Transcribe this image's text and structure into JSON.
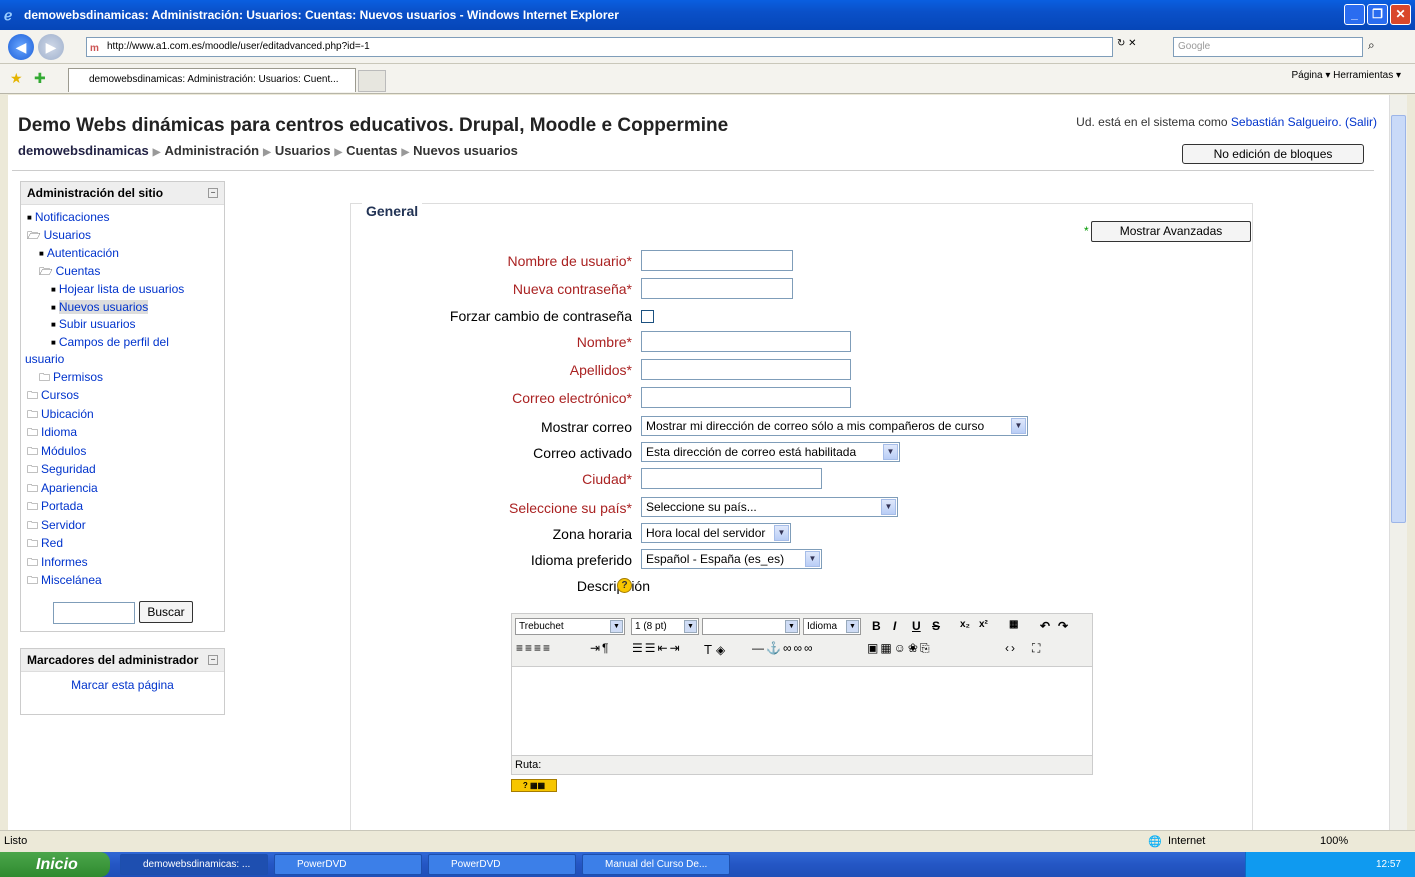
{
  "window": {
    "title": "demowebsdinamicas: Administración: Usuarios: Cuentas: Nuevos usuarios - Windows Internet Explorer",
    "url": "http://www.a1.com.es/moodle/user/editadvanced.php?id=-1",
    "search_placeholder": "Google",
    "tab_label": "demowebsdinamicas: Administración: Usuarios: Cuent...",
    "command_bar": "Página ▾   Herramientas ▾"
  },
  "header": {
    "site_title": "Demo Webs dinámicas para centros educativos. Drupal, Moodle e Coppermine",
    "login_prefix": "Ud. está en el sistema como",
    "login_user": "Sebastián Salgueiro.",
    "logout": "(Salir)",
    "breadcrumb": [
      "demowebsdinamicas",
      "Administración",
      "Usuarios",
      "Cuentas",
      "Nuevos usuarios"
    ],
    "edit_blocks_button": "No edición de bloques"
  },
  "sidebar": {
    "admin_block_title": "Administración del sitio",
    "items": [
      {
        "label": "Notificaciones",
        "type": "item",
        "indent": 0
      },
      {
        "label": "Usuarios",
        "type": "open-folder",
        "indent": 0
      },
      {
        "label": "Autenticación",
        "type": "item",
        "indent": 1
      },
      {
        "label": "Cuentas",
        "type": "open-folder",
        "indent": 1
      },
      {
        "label": "Hojear lista de usuarios",
        "type": "item",
        "indent": 2
      },
      {
        "label": "Nuevos usuarios",
        "type": "item",
        "indent": 2
      },
      {
        "label": "Subir usuarios",
        "type": "item",
        "indent": 2
      },
      {
        "label": "Campos de perfil del",
        "type": "item",
        "indent": 2
      },
      {
        "label": "usuario",
        "type": "wrap",
        "indent": 0
      },
      {
        "label": "Permisos",
        "type": "folder",
        "indent": 1
      },
      {
        "label": "Cursos",
        "type": "folder",
        "indent": 0
      },
      {
        "label": "Ubicación",
        "type": "folder",
        "indent": 0
      },
      {
        "label": "Idioma",
        "type": "folder",
        "indent": 0
      },
      {
        "label": "Módulos",
        "type": "folder",
        "indent": 0
      },
      {
        "label": "Seguridad",
        "type": "folder",
        "indent": 0
      },
      {
        "label": "Apariencia",
        "type": "folder",
        "indent": 0
      },
      {
        "label": "Portada",
        "type": "folder",
        "indent": 0
      },
      {
        "label": "Servidor",
        "type": "folder",
        "indent": 0
      },
      {
        "label": "Red",
        "type": "folder",
        "indent": 0
      },
      {
        "label": "Informes",
        "type": "folder",
        "indent": 0
      },
      {
        "label": "Miscelánea",
        "type": "folder",
        "indent": 0
      }
    ],
    "search_button": "Buscar",
    "bookmarks_title": "Marcadores del administrador",
    "bookmark_link": "Marcar esta página"
  },
  "form": {
    "legend": "General",
    "advanced_button": "Mostrar Avanzadas",
    "fields": {
      "username": "Nombre de usuario*",
      "password": "Nueva contraseña*",
      "force_change": "Forzar cambio de contraseña",
      "firstname": "Nombre*",
      "lastname": "Apellidos*",
      "email": "Correo electrónico*",
      "mail_display": "Mostrar correo",
      "mail_display_value": "Mostrar mi dirección de correo sólo a mis compañeros de curso",
      "email_enabled": "Correo activado",
      "email_enabled_value": "Esta dirección de correo está habilitada",
      "city": "Ciudad*",
      "country": "Seleccione su país*",
      "country_value": "Seleccione su país...",
      "timezone": "Zona horaria",
      "timezone_value": "Hora local del servidor",
      "language": "Idioma preferido",
      "language_value": "Español - España (es_es)",
      "description": "Descripción"
    },
    "editor": {
      "font": "Trebuchet",
      "size": "1 (8 pt)",
      "lang": "Idioma",
      "path_label": "Ruta:"
    }
  },
  "status": {
    "left": "Listo",
    "zone": "Internet",
    "zoom": "100%"
  },
  "taskbar": {
    "start": "Inicio",
    "items": [
      "demowebsdinamicas: ...",
      "PowerDVD",
      "PowerDVD",
      "Manual del Curso De..."
    ],
    "clock": "12:57"
  }
}
